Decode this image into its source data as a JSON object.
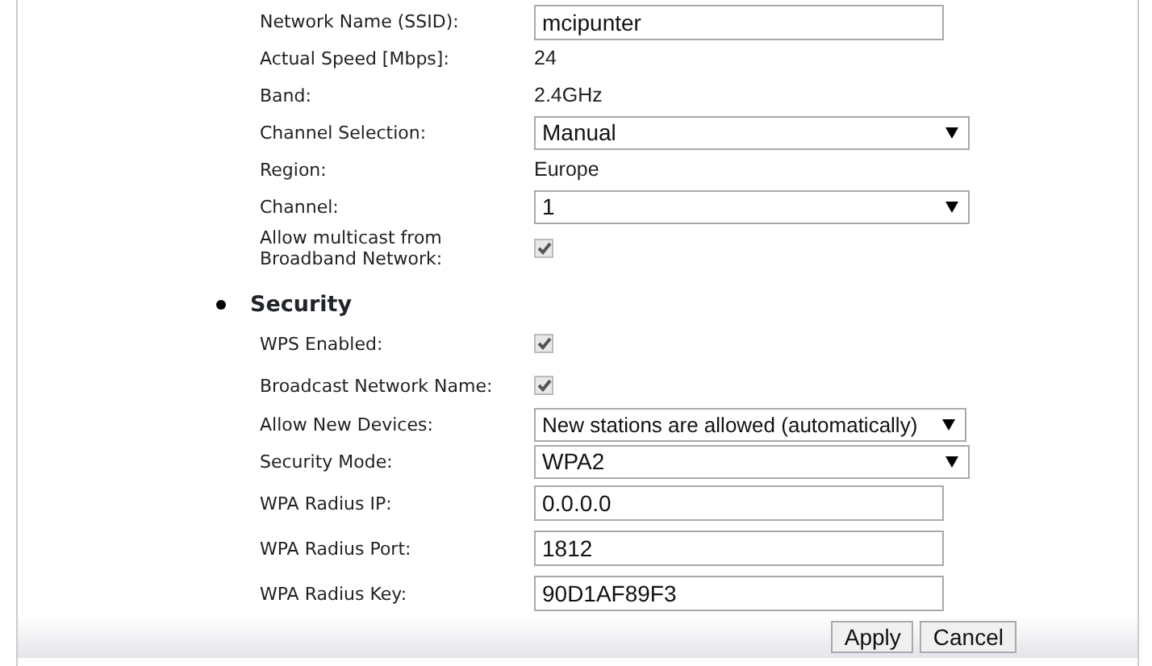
{
  "wireless_rows": [
    {
      "kind": "input",
      "label": "Network Name (SSID):",
      "value": "mcipunter"
    },
    {
      "kind": "text",
      "label": "Actual Speed [Mbps]:",
      "value": "24"
    },
    {
      "kind": "text",
      "label": "Band:",
      "value": "2.4GHz"
    },
    {
      "kind": "select",
      "label": "Channel Selection:",
      "value": "Manual"
    },
    {
      "kind": "text",
      "label": "Region:",
      "value": "Europe"
    },
    {
      "kind": "select",
      "label": "Channel:",
      "value": "1"
    },
    {
      "kind": "checkbox",
      "label": "Allow multicast from Broadband Network:",
      "checked": true
    }
  ],
  "security": {
    "heading": "Security",
    "rows": [
      {
        "kind": "checkbox",
        "label": "WPS Enabled:",
        "checked": true
      },
      {
        "kind": "checkbox",
        "label": "Broadcast Network Name:",
        "checked": true
      },
      {
        "kind": "select",
        "label": "Allow New Devices:",
        "value": "New stations are allowed (automatically)"
      },
      {
        "kind": "select",
        "label": "Security Mode:",
        "value": "WPA2"
      },
      {
        "kind": "input",
        "label": "WPA Radius IP:",
        "value": "0.0.0.0"
      },
      {
        "kind": "input",
        "label": "WPA Radius Port:",
        "value": "1812"
      },
      {
        "kind": "input",
        "label": "WPA Radius Key:",
        "value": "90D1AF89F3"
      }
    ]
  },
  "buttons": [
    {
      "label": "Apply"
    },
    {
      "label": "Cancel"
    }
  ]
}
